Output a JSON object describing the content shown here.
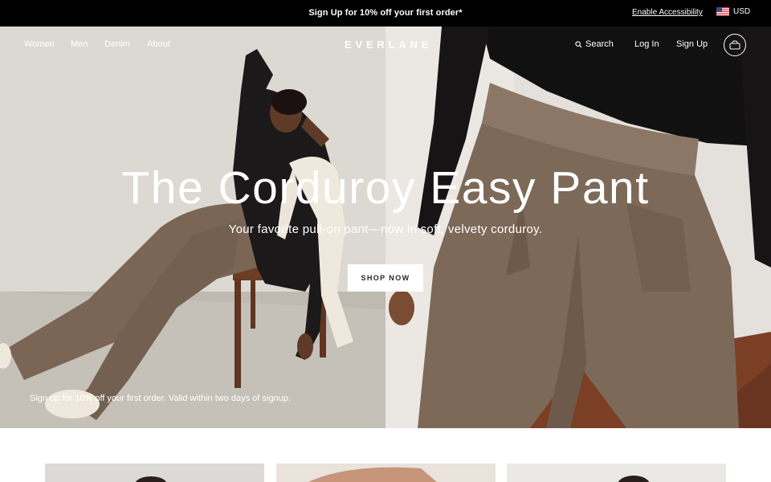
{
  "promo": {
    "text": "Sign Up for 10% off your first order*",
    "accessibility": "Enable Accessibility",
    "currency": "USD",
    "currency_flag_icon": "us-flag-icon"
  },
  "nav": {
    "items": [
      "Women",
      "Men",
      "Denim",
      "About"
    ],
    "logo": "EVERLANE",
    "search": "Search",
    "login": "Log In",
    "signup": "Sign Up",
    "cart_icon": "shopping-bag-icon"
  },
  "hero": {
    "title": "The Corduroy Easy Pant",
    "subtitle": "Your favorite pull-on pant—now in soft, velvety corduroy.",
    "cta": "SHOP NOW",
    "note": "Sign up for 10% off your first order. Valid within two days of signup."
  },
  "colors": {
    "promo_bg": "#000000",
    "corduroy": "#7a6654",
    "sweater": "#1c1a1a",
    "wall_left": "#d8d5cf",
    "wall_right": "#e6e3de"
  }
}
